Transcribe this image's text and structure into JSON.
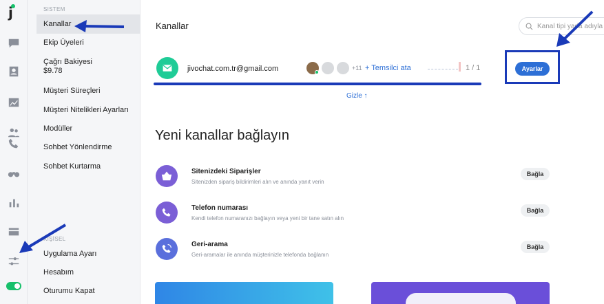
{
  "rail": {
    "logo": "j",
    "icons": [
      "chat-icon",
      "contacts-icon",
      "analytics-icon",
      "team-icon",
      "phone-icon",
      "binoculars-icon",
      "reports-icon",
      "billing-icon",
      "settings-sliders-icon",
      "online-toggle"
    ]
  },
  "sidebar": {
    "section_system": "SISTEM",
    "items": [
      {
        "label": "Kanallar",
        "active": true
      },
      {
        "label": "Ekip Üyeleri"
      },
      {
        "label": "Çağrı Bakiyesi",
        "sub": "$9.78"
      },
      {
        "label": "Müşteri Süreçleri"
      },
      {
        "label": "Müşteri Nitelikleri Ayarları"
      },
      {
        "label": "Modüller"
      },
      {
        "label": "Sohbet Yönlendirme"
      },
      {
        "label": "Sohbet Kurtarma"
      }
    ],
    "section_personal": "KİŞİSEL",
    "personal_items": [
      {
        "label": "Uygulama Ayarı"
      },
      {
        "label": "Hesabım"
      },
      {
        "label": "Oturumu Kapat"
      }
    ]
  },
  "main": {
    "title": "Kanallar",
    "search_placeholder": "Kanal tipi yada adıyla",
    "channel": {
      "name": "jivochat.com.tr@gmail.com",
      "more_agents": "+11",
      "assign_label": "+ Temsilci ata",
      "count": "1 / 1",
      "settings_label": "Ayarlar"
    },
    "hide_label": "Gizle ↑",
    "connect_heading": "Yeni kanallar bağlayın",
    "integrations": [
      {
        "title": "Sitenizdeki Siparişler",
        "desc": "Sitenizden sipariş bildirimleri alın ve anında yanıt verin",
        "button": "Bağla",
        "color": "#7b5fd6",
        "icon": "basket-icon"
      },
      {
        "title": "Telefon numarası",
        "desc": "Kendi telefon numaranızı bağlayın veya yeni bir tane satın alın",
        "button": "Bağla",
        "color": "#7b5fd6",
        "icon": "phone-icon"
      },
      {
        "title": "Geri-arama",
        "desc": "Geri-aramalar ile anında müşterinizle telefonda bağlanın",
        "button": "Bağla",
        "color": "#5a6fdc",
        "icon": "callback-icon"
      }
    ]
  },
  "colors": {
    "accent": "#2d6fd6",
    "annotation": "#1a3ab8",
    "email_channel": "#1fcc97",
    "online": "#17c06b"
  }
}
